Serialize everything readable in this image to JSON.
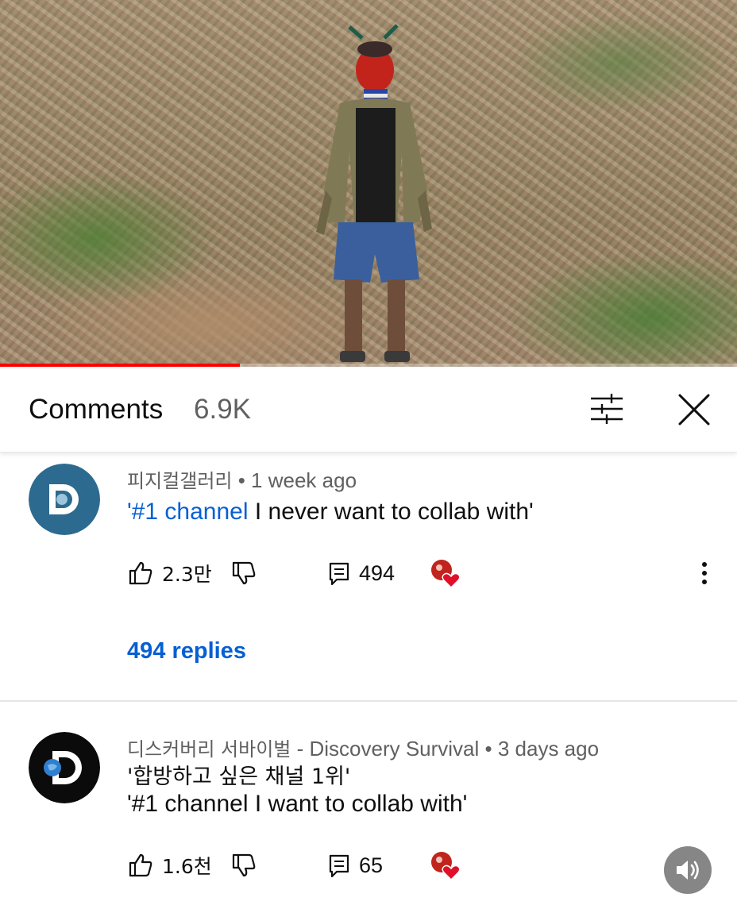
{
  "player": {
    "progress": 0.325,
    "colors": {
      "progress": "#ff0000"
    }
  },
  "comments_panel": {
    "title": "Comments",
    "count": "6.9K",
    "filter_icon": "sliders-icon",
    "close_icon": "close-icon"
  },
  "comments": [
    {
      "author": "피지컬갤러리",
      "separator": " • ",
      "time": "1 week ago",
      "text_hashtag": "'#1 channel",
      "text_rest": " I never want to collab with'",
      "likes": "2.3만",
      "reply_count": "494",
      "replies_link": "494 replies",
      "avatar_icon": "discovery-logo-icon"
    },
    {
      "author": "디스커버리 서바이벌",
      "author_suffix": " - Discovery Survival",
      "separator": " • ",
      "time": "3 days ago",
      "text_line1": "'합방하고 싶은 채널 1위'",
      "text_line2": "'#1 channel I want to collab with'",
      "likes": "1.6천",
      "reply_count": "65",
      "avatar_icon": "discovery-logo-icon"
    }
  ],
  "colors": {
    "link": "#065fd4",
    "meta": "#606060",
    "text": "#0f0f0f"
  }
}
